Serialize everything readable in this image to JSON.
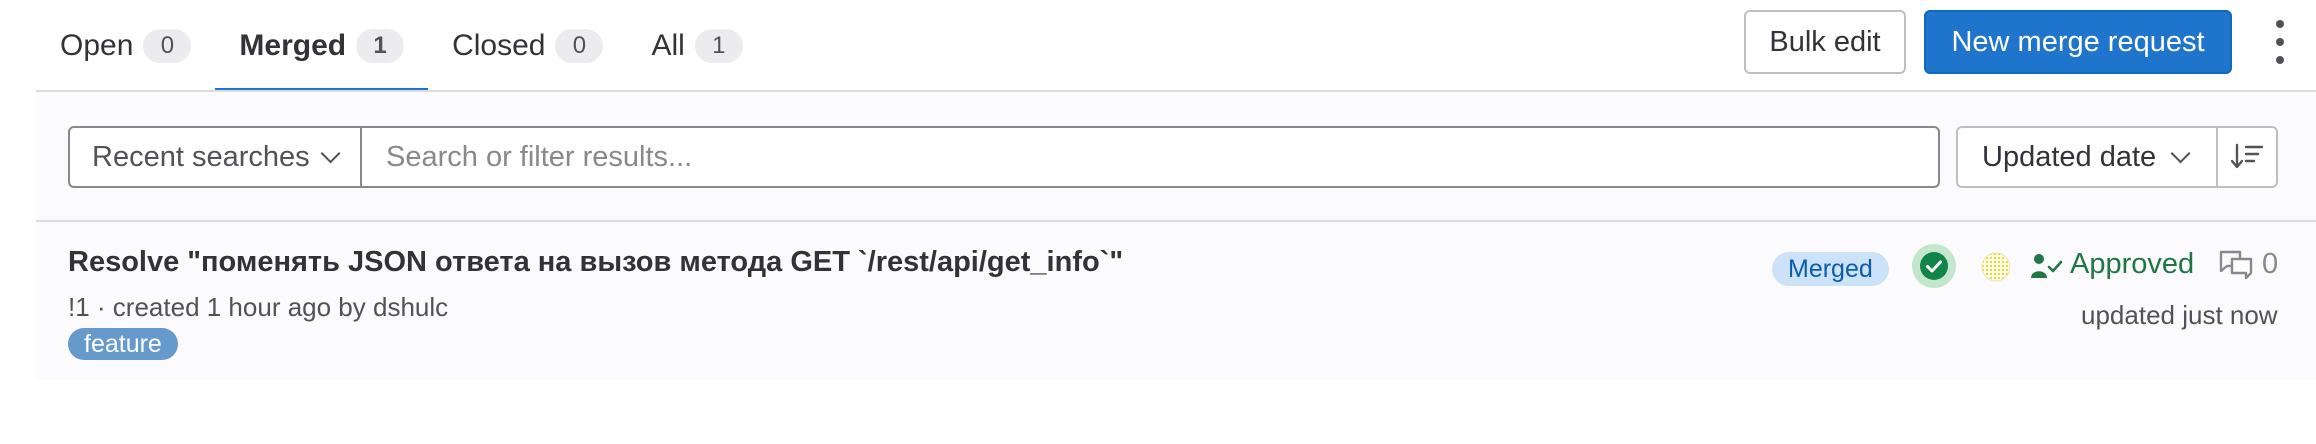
{
  "tabs": [
    {
      "label": "Open",
      "count": "0"
    },
    {
      "label": "Merged",
      "count": "1"
    },
    {
      "label": "Closed",
      "count": "0"
    },
    {
      "label": "All",
      "count": "1"
    }
  ],
  "active_tab": "Merged",
  "actions": {
    "bulk_edit_label": "Bulk edit",
    "new_mr_label": "New merge request"
  },
  "filter": {
    "recent_searches_label": "Recent searches",
    "search_placeholder": "Search or filter results...",
    "search_value": "",
    "sort_label": "Updated date"
  },
  "merge_requests": [
    {
      "title": "Resolve \"поменять JSON ответа на вызов метода GET `/rest/api/get_info`\"",
      "reference": "!1",
      "created_text": "· created 1 hour ago by",
      "author": "dshulc",
      "labels": [
        "feature"
      ],
      "status_badge": "Merged",
      "approval_text": "Approved",
      "comment_count": "0",
      "updated_text": "updated just now"
    }
  ],
  "icons": {
    "pipeline": "check-circle-icon",
    "approval": "approval-user-check-icon",
    "comments": "comments-icon",
    "sort_direction": "sort-lowest-icon",
    "more": "kebab-vertical-icon"
  },
  "colors": {
    "accent": "#1f75cb",
    "success": "#217645",
    "merged_badge_bg": "#cbe2f9",
    "label_feature": "#6699cc"
  }
}
